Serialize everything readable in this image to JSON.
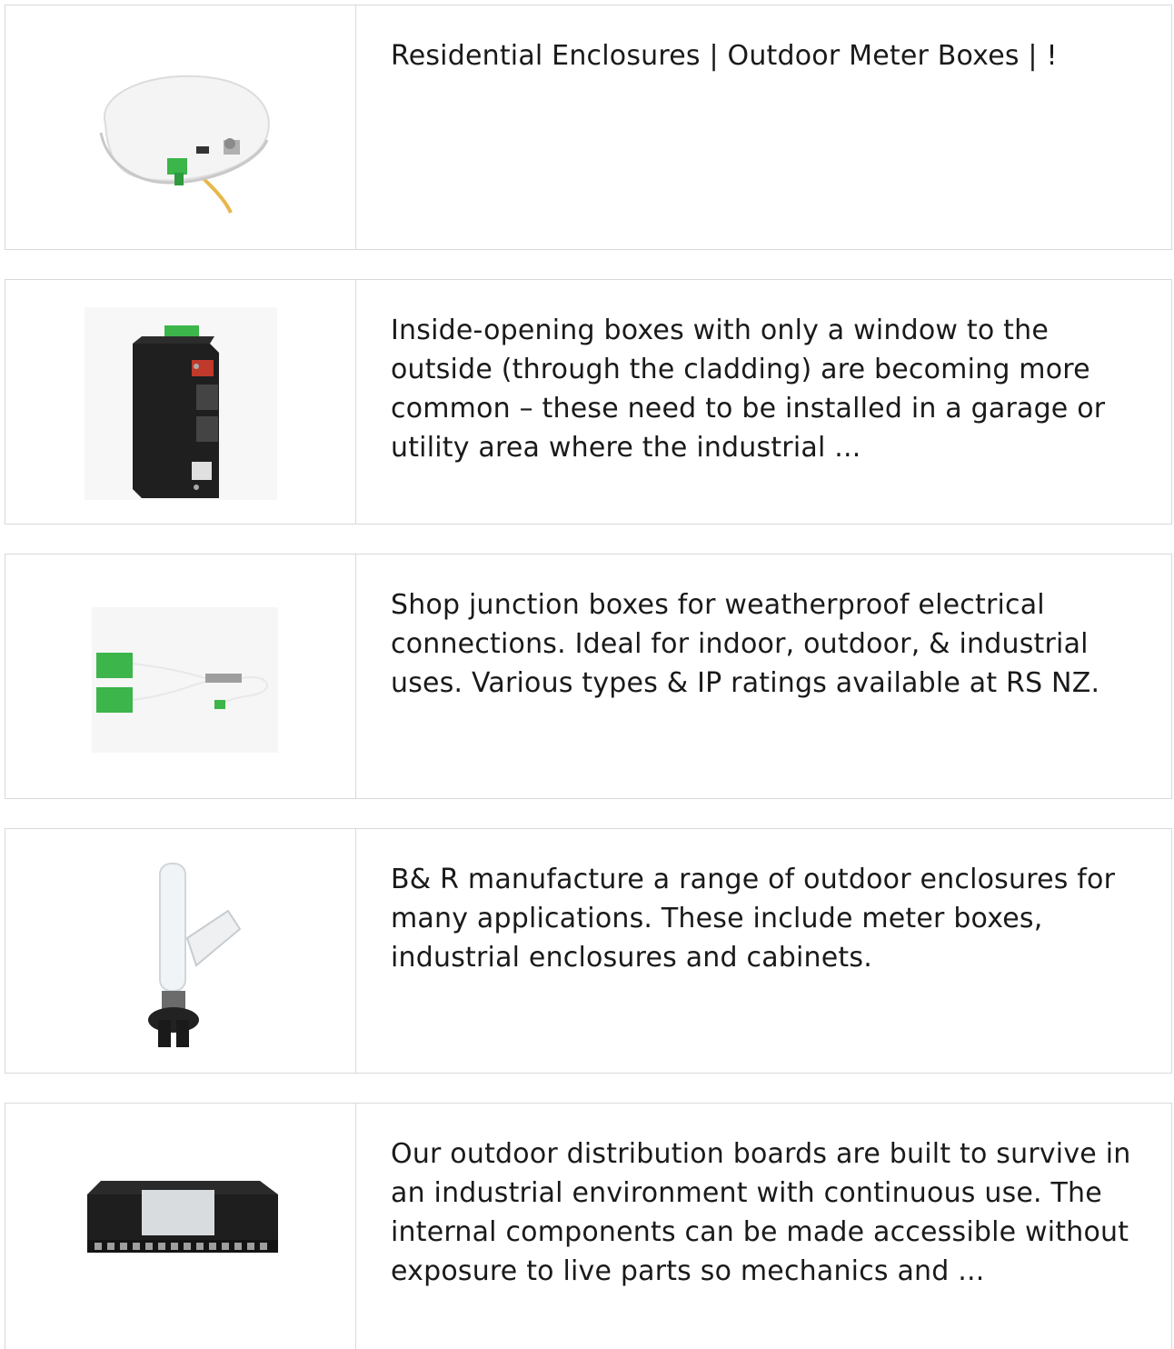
{
  "results": [
    {
      "image_icon": "fiber-terminal-box-image",
      "text": "Residential Enclosures | Outdoor Meter Boxes | !"
    },
    {
      "image_icon": "industrial-media-converter-image",
      "text": "Inside-opening boxes with only a window to the outside (through the cladding) are becoming more common – these need to be installed in a garage or utility area where the industrial ..."
    },
    {
      "image_icon": "fiber-splitter-image",
      "text": "Shop junction boxes for weatherproof electrical connections. Ideal for indoor, outdoor, & industrial uses. Various types & IP ratings available at RS NZ."
    },
    {
      "image_icon": "splice-closure-image",
      "text": "B& R manufacture a range of outdoor enclosures for many applications. These include meter boxes, industrial enclosures and cabinets."
    },
    {
      "image_icon": "patch-panel-image",
      "text": "Our outdoor distribution boards are built to survive in an industrial environment with continuous use. The internal components can be made accessible without exposure to live parts so mechanics and ..."
    }
  ],
  "colors": {
    "border": "#d9d9d9",
    "text": "#1a1a1a",
    "connector_green": "#3cb54a",
    "cable_yellow": "#e6b84a"
  }
}
